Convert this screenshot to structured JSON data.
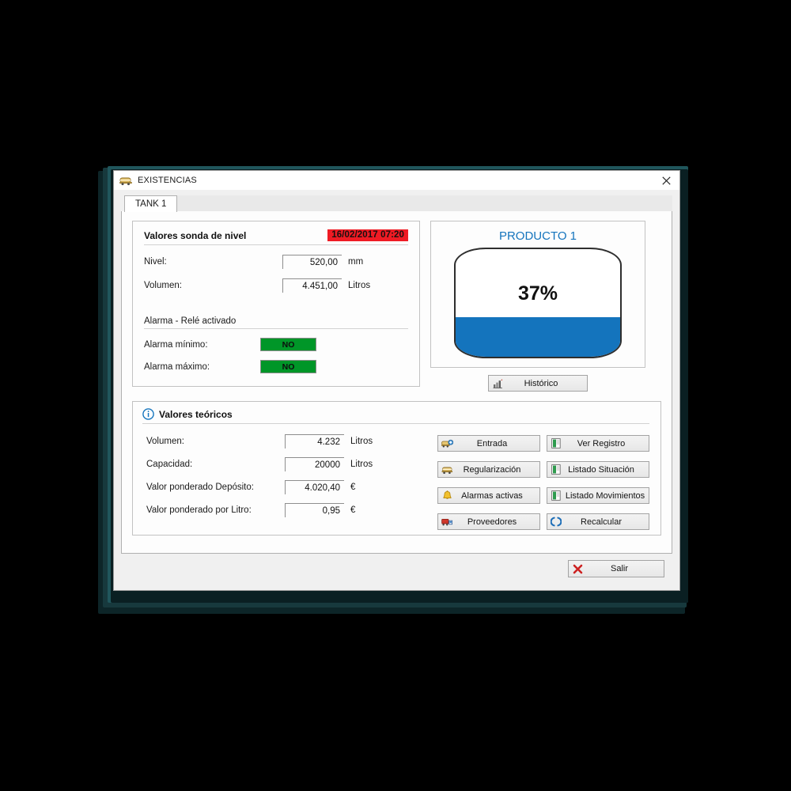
{
  "window": {
    "title": "EXISTENCIAS",
    "title_icon": "tanker-truck-icon",
    "close_icon": "close-icon"
  },
  "tabs": [
    {
      "label": "TANK 1",
      "selected": true
    }
  ],
  "probe_panel": {
    "title": "Valores sonda de nivel",
    "timestamp": "16/02/2017 07:20",
    "timestamp_bg": "#ef1b24",
    "fields": [
      {
        "label": "Nivel:",
        "value": "520,00",
        "unit": "mm"
      },
      {
        "label": "Volumen:",
        "value": "4.451,00",
        "unit": "Litros"
      }
    ],
    "alarm_section_title": "Alarma - Relé activado",
    "alarms": [
      {
        "label": "Alarma mínimo:",
        "value": "NO",
        "color": "#009628"
      },
      {
        "label": "Alarma máximo:",
        "value": "NO",
        "color": "#009628"
      }
    ]
  },
  "tank_panel": {
    "product": "PRODUCTO 1",
    "product_color": "#1474bd",
    "percent_label": "37%",
    "percent_value": 37,
    "fill_color": "#1474bd",
    "historico_button": {
      "label": "Histórico",
      "icon": "bar-chart-icon"
    }
  },
  "theoretical_panel": {
    "title": "Valores teóricos",
    "info_icon": "info-icon",
    "fields": [
      {
        "label": "Volumen:",
        "value": "4.232",
        "unit": "Litros"
      },
      {
        "label": "Capacidad:",
        "value": "20000",
        "unit": "Litros"
      },
      {
        "label": "Valor ponderado Depósito:",
        "value": "4.020,40",
        "unit": "€"
      },
      {
        "label": "Valor ponderado por Litro:",
        "value": "0,95",
        "unit": "€"
      }
    ],
    "buttons": [
      {
        "label": "Entrada",
        "icon": "truck-add-icon"
      },
      {
        "label": "Ver Registro",
        "icon": "report-icon"
      },
      {
        "label": "Regularización",
        "icon": "tanker-truck-icon"
      },
      {
        "label": "Listado Situación",
        "icon": "report-icon"
      },
      {
        "label": "Alarmas activas",
        "icon": "bell-icon"
      },
      {
        "label": "Listado Movimientos",
        "icon": "report-icon"
      },
      {
        "label": "Proveedores",
        "icon": "supplier-truck-icon"
      },
      {
        "label": "Recalcular",
        "icon": "refresh-icon"
      }
    ]
  },
  "footer": {
    "exit_button": {
      "label": "Salir",
      "icon": "red-x-icon"
    }
  }
}
